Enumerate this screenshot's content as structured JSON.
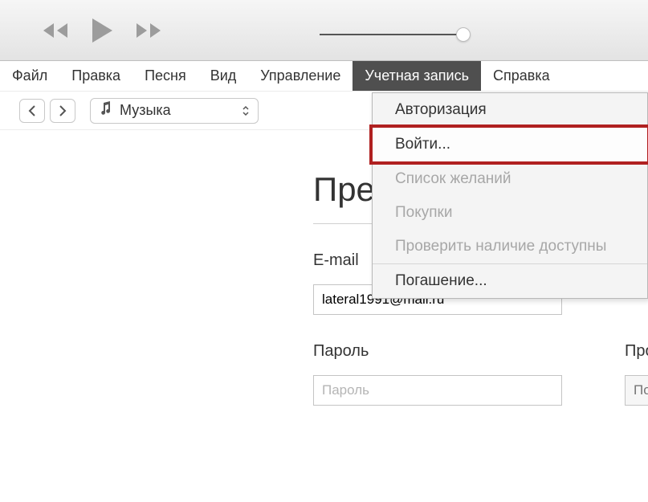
{
  "menubar": {
    "items": [
      "Файл",
      "Правка",
      "Песня",
      "Вид",
      "Управление",
      "Учетная запись",
      "Справка"
    ],
    "active_index": 5
  },
  "toolbar": {
    "library_label": "Музыка"
  },
  "dropdown": {
    "sections": [
      {
        "items": [
          {
            "label": "Авторизация",
            "disabled": false
          }
        ]
      },
      {
        "items": [
          {
            "label": "Войти...",
            "disabled": false,
            "highlight": true
          }
        ]
      },
      {
        "items": [
          {
            "label": "Список желаний",
            "disabled": true
          },
          {
            "label": "Покупки",
            "disabled": true
          },
          {
            "label": "Проверить наличие доступны",
            "disabled": true
          }
        ]
      },
      {
        "items": [
          {
            "label": "Погашение...",
            "disabled": false
          }
        ]
      }
    ]
  },
  "page": {
    "title_partial": "Пре"
  },
  "form": {
    "email_label": "E-mail",
    "email_value": "lateral1991@mail.ru",
    "password_label": "Пароль",
    "password_placeholder": "Пароль",
    "confirm_label_partial": "Пров",
    "confirm_placeholder_partial": "Повт"
  }
}
